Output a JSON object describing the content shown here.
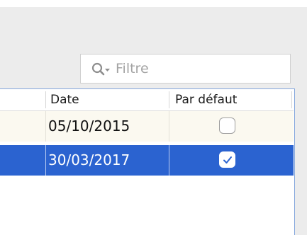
{
  "search": {
    "placeholder": "Filtre",
    "icon": "search-dropdown-icon"
  },
  "table": {
    "columns": [
      {
        "label": "Date"
      },
      {
        "label": "Par défaut"
      }
    ],
    "rows": [
      {
        "date": "05/10/2015",
        "default": false,
        "selected": false
      },
      {
        "date": "30/03/2017",
        "default": true,
        "selected": true
      }
    ]
  },
  "colors": {
    "selection": "#2b63d0",
    "focus_border": "#84a6dc",
    "row_alt": "#fbf9f0",
    "panel_bg": "#ececec"
  }
}
